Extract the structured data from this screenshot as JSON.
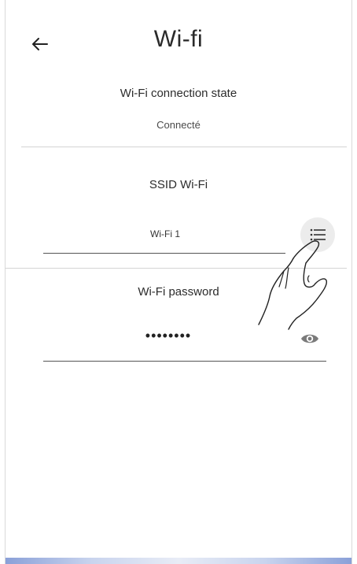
{
  "header": {
    "title": "Wi-fi",
    "back_icon": "arrow-left-icon"
  },
  "connection": {
    "label": "Wi-Fi connection state",
    "value": "Connecté"
  },
  "ssid": {
    "label": "SSID Wi-Fi",
    "value": "Wi-Fi 1",
    "list_icon": "list-icon"
  },
  "password": {
    "label": "Wi-Fi password",
    "value": "••••••••",
    "visibility_icon": "eye-icon"
  },
  "overlay": {
    "hand_icon": "pointing-hand-icon"
  }
}
